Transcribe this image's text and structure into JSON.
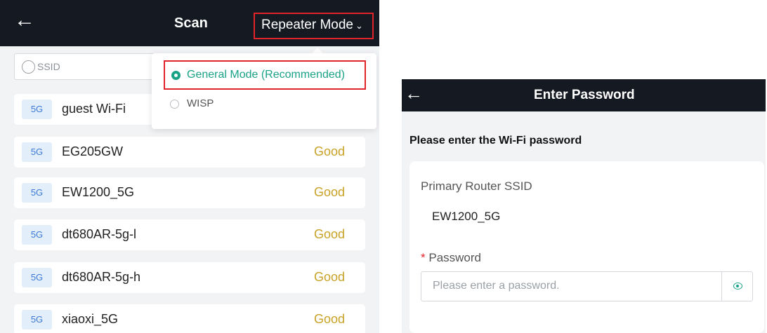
{
  "scan_screen": {
    "back_icon": "←",
    "title": "Scan",
    "mode_select": {
      "value": "Repeater Mode",
      "chevron": "⌄"
    },
    "search": {
      "placeholder": "SSID"
    },
    "networks": [
      {
        "band": "5G",
        "ssid": "guest Wi-Fi",
        "signal": ""
      },
      {
        "band": "5G",
        "ssid": "EG205GW",
        "signal": "Good"
      },
      {
        "band": "5G",
        "ssid": "EW1200_5G",
        "signal": "Good"
      },
      {
        "band": "5G",
        "ssid": "dt680AR-5g-l",
        "signal": "Good"
      },
      {
        "band": "5G",
        "ssid": "dt680AR-5g-h",
        "signal": "Good"
      },
      {
        "band": "5G",
        "ssid": "xiaoxi_5G",
        "signal": "Good"
      }
    ],
    "mode_dropdown": {
      "options": [
        {
          "label": "General Mode (Recommended)",
          "selected": true
        },
        {
          "label": "WISP",
          "selected": false
        }
      ]
    }
  },
  "password_screen": {
    "back_icon": "←",
    "title": "Enter Password",
    "prompt": "Please enter the Wi-Fi password",
    "ssid_label": "Primary Router SSID",
    "ssid_value": "EW1200_5G",
    "password_required_mark": "*",
    "password_label": "Password",
    "password_placeholder": "Please enter a password."
  },
  "colors": {
    "header_bg": "#151a22",
    "accent_green": "#1aa287",
    "highlight_red": "#e0242a",
    "signal_gold": "#c9a227",
    "band_blue": "#3d7ad6"
  }
}
